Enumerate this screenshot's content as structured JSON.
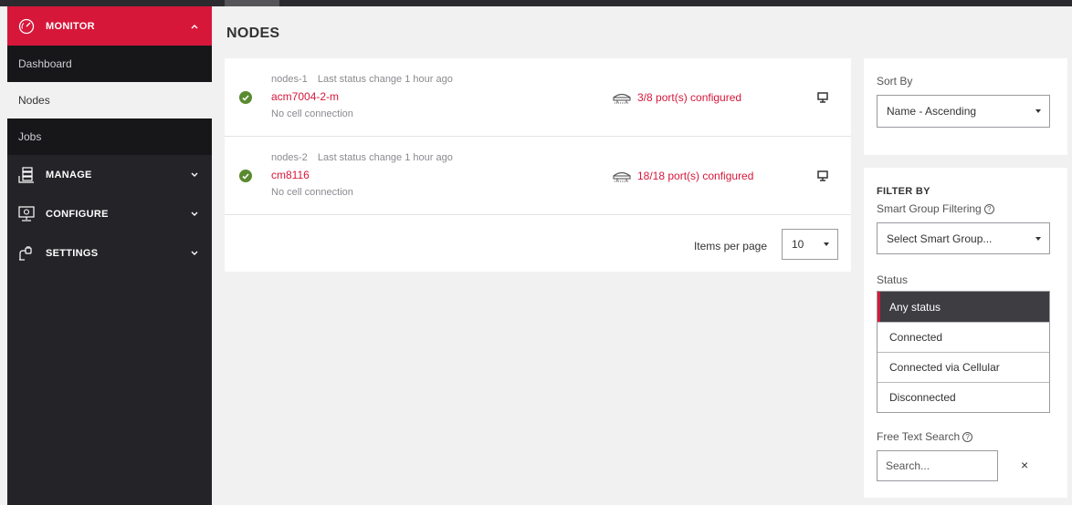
{
  "sidebar": {
    "monitor": {
      "label": "MONITOR",
      "items": [
        "Dashboard",
        "Nodes",
        "Jobs"
      ]
    },
    "manage": {
      "label": "MANAGE"
    },
    "configure": {
      "label": "CONFIGURE"
    },
    "settings": {
      "label": "SETTINGS"
    }
  },
  "page": {
    "title": "NODES"
  },
  "nodes": [
    {
      "group": "nodes-1",
      "status_change": "Last status change 1 hour ago",
      "name": "acm7004-2-m",
      "cell": "No cell connection",
      "ports": "3/8 port(s) configured"
    },
    {
      "group": "nodes-2",
      "status_change": "Last status change 1 hour ago",
      "name": "cm8116",
      "cell": "No cell connection",
      "ports": "18/18 port(s) configured"
    }
  ],
  "pager": {
    "items_per_page_label": "Items per page",
    "items_per_page_value": "10"
  },
  "sort": {
    "label": "Sort By",
    "value": "Name - Ascending"
  },
  "filter": {
    "title": "FILTER BY",
    "smart_group_label": "Smart Group Filtering",
    "smart_group_value": "Select Smart Group...",
    "status_label": "Status",
    "status_options": [
      "Any status",
      "Connected",
      "Connected via Cellular",
      "Disconnected"
    ],
    "search_label": "Free Text Search",
    "search_placeholder": "Search...",
    "clear_label": "×"
  },
  "colors": {
    "brand": "#d6173a",
    "sidebar": "#242428",
    "ok": "#5a8a2f"
  }
}
